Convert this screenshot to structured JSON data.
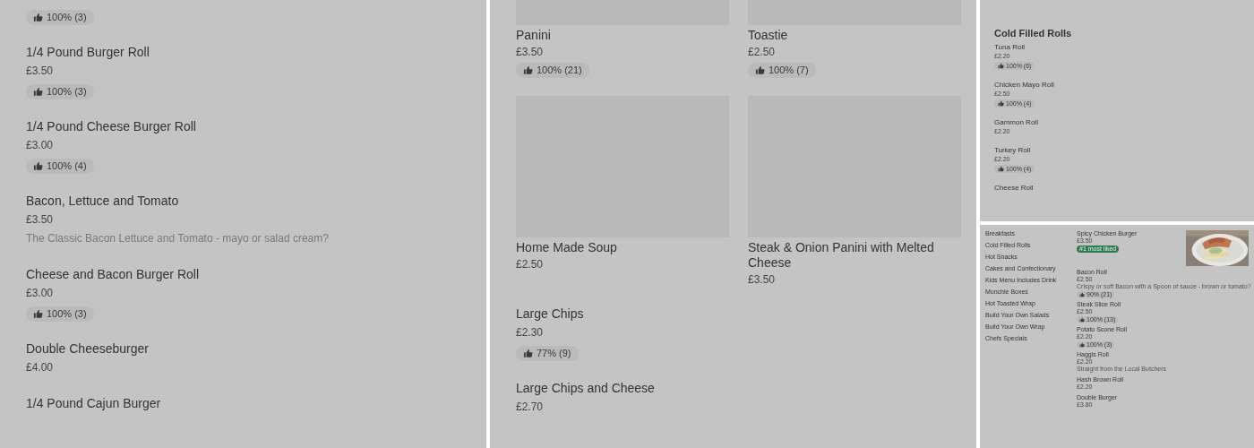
{
  "left_panel": {
    "items": [
      {
        "rating": "100% (3)"
      },
      {
        "name": "1/4 Pound Burger Roll",
        "price": "£3.50",
        "rating": "100% (3)"
      },
      {
        "name": "1/4 Pound Cheese Burger Roll",
        "price": "£3.00",
        "rating": "100% (4)"
      },
      {
        "name": "Bacon, Lettuce and Tomato",
        "price": "£3.50",
        "description": "The Classic Bacon Lettuce and Tomato - mayo or salad cream?"
      },
      {
        "name": "Cheese and Bacon Burger Roll",
        "price": "£3.00",
        "rating": "100% (3)"
      },
      {
        "name": "Double Cheeseburger",
        "price": "£4.00"
      },
      {
        "name": "1/4 Pound Cajun Burger"
      }
    ]
  },
  "middle_panel": {
    "cards": [
      {
        "name": "Panini",
        "price": "£3.50",
        "rating": "100% (21)"
      },
      {
        "name": "Toastie",
        "price": "£2.50",
        "rating": "100% (7)"
      }
    ],
    "cards_2": [
      {
        "name": "Home Made Soup",
        "price": "£2.50"
      },
      {
        "name": "Steak & Onion Panini with Melted Cheese",
        "price": "£3.50"
      }
    ],
    "items": [
      {
        "name": "Large Chips",
        "price": "£2.30",
        "rating": "77% (9)"
      },
      {
        "name": "Large Chips and Cheese",
        "price": "£2.70"
      }
    ]
  },
  "right_top_panel": {
    "section_title": "Cold Filled Rolls",
    "items": [
      {
        "name": "Tuna Roll",
        "price": "£2.20",
        "rating": "100% (6)"
      },
      {
        "name": "Chicken Mayo Roll",
        "price": "£2.50",
        "rating": "100% (4)"
      },
      {
        "name": "Gammon Roll",
        "price": "£2.20"
      },
      {
        "name": "Turkey Roll",
        "price": "£2.20",
        "rating": "100% (4)"
      },
      {
        "name": "Cheese Roll"
      }
    ]
  },
  "right_bottom_panel": {
    "categories": [
      "Breakfasts",
      "Cold Filled Rolls",
      "Hot Snacks",
      "Cakes and Confectionary",
      "Kids Menu Includes Drink",
      "Munchie Boxes",
      "Hot Toasted Wrap",
      "Build Your Own Salads",
      "Build Your Own Wrap",
      "Chefs Specials"
    ],
    "items": [
      {
        "name": "Spicy Chicken Burger",
        "price": "£3.50",
        "tag": "#1 most liked"
      },
      {
        "name": "Bacon Roll",
        "price": "£2.50",
        "description": "Crispy or soft Bacon with a Spoon of sauce - brown or tomato?",
        "rating": "90% (21)"
      },
      {
        "name": "Steak Slice Roll",
        "price": "£2.50",
        "rating": "100% (13)"
      },
      {
        "name": "Potato Scone Roll",
        "price": "£2.20",
        "rating": "100% (3)"
      },
      {
        "name": "Haggis Roll",
        "price": "£2.20",
        "description": "Straight from the Local Butchers"
      },
      {
        "name": "Hash Brown Roll",
        "price": "£2.20"
      },
      {
        "name": "Double Burger",
        "price": "£3.80"
      }
    ]
  }
}
